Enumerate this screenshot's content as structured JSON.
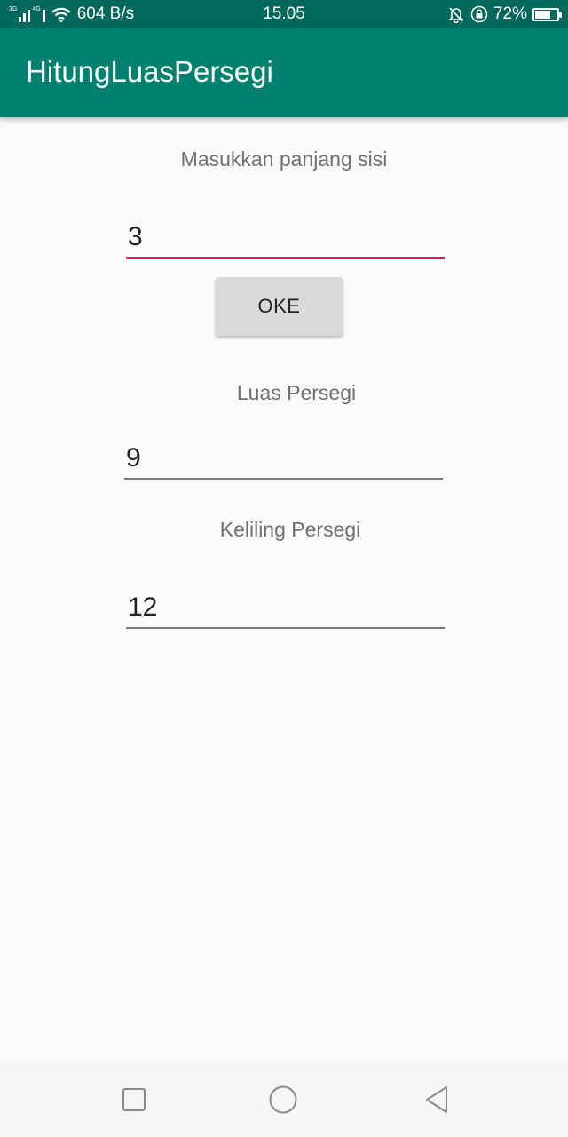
{
  "status_bar": {
    "net_tag_1": "3G",
    "net_tag_2": "4G",
    "speed": "604 B/s",
    "time": "15.05",
    "battery": "72%",
    "battery_level": 0.72,
    "icons": [
      "signal-icon",
      "wifi-icon",
      "alarm-off-icon",
      "lock-rotation-icon",
      "battery-icon"
    ]
  },
  "app_bar": {
    "title": "HitungLuasPersegi"
  },
  "form": {
    "side_label": "Masukkan panjang sisi",
    "side_value": "3",
    "ok_label": "OKE",
    "area_label": "Luas Persegi",
    "area_value": "9",
    "perimeter_label": "Keliling Persegi",
    "perimeter_value": "12"
  },
  "nav_bar": {
    "buttons": [
      "recents-icon",
      "home-icon",
      "back-icon"
    ]
  },
  "colors": {
    "status_bar": "#00695c",
    "app_bar": "#00806f",
    "accent": "#d81b60",
    "background": "#fafafa"
  }
}
